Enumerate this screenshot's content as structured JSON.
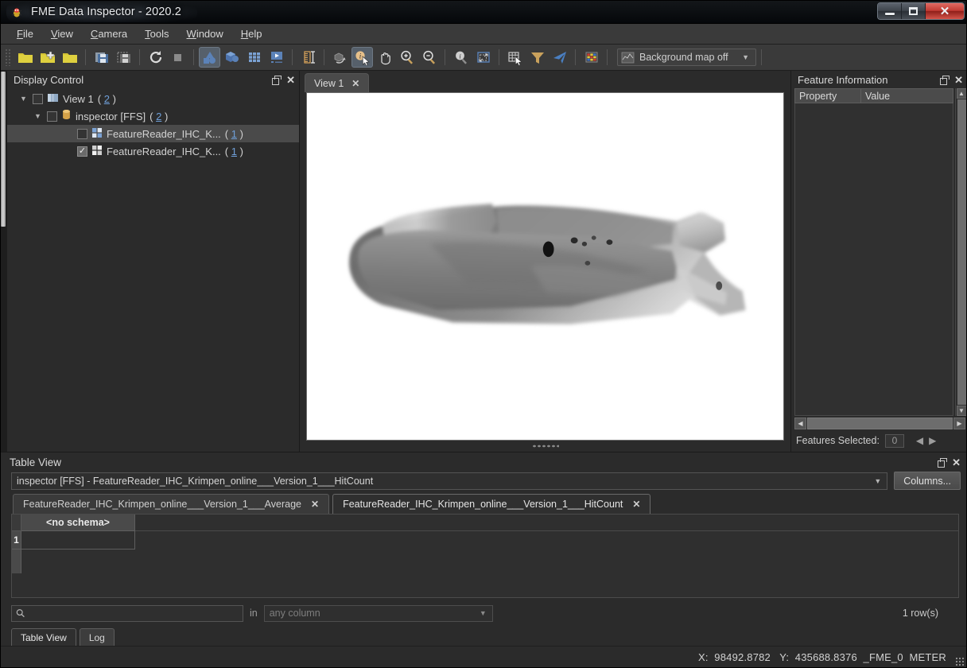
{
  "window": {
    "title": "FME Data Inspector - 2020.2",
    "app_icon": "fme-bug-icon",
    "minimize": "minimize-button",
    "maximize": "maximize-button",
    "close": "close-button"
  },
  "menu": {
    "items": [
      {
        "label": "File",
        "mnemonic": "F"
      },
      {
        "label": "View",
        "mnemonic": "V"
      },
      {
        "label": "Camera",
        "mnemonic": "C"
      },
      {
        "label": "Tools",
        "mnemonic": "T"
      },
      {
        "label": "Window",
        "mnemonic": "W"
      },
      {
        "label": "Help",
        "mnemonic": "H"
      }
    ]
  },
  "toolbar": {
    "background_map_label": "Background map off",
    "icons": [
      "open-folder-icon",
      "add-dataset-icon",
      "open-recent-folder-icon",
      "save-icon",
      "save-as-icon",
      "refresh-icon",
      "stop-icon",
      "show-features-icon",
      "3d-view-icon",
      "grid-view-icon",
      "animation-icon",
      "measure-icon",
      "rotate-icon",
      "info-select-icon",
      "pan-icon",
      "zoom-in-icon",
      "zoom-out-icon",
      "identify-icon",
      "zoom-to-box-icon",
      "table-select-icon",
      "filter-icon",
      "navigate-icon",
      "color-palette-icon",
      "background-map-icon"
    ]
  },
  "display_control": {
    "title": "Display Control",
    "tree": [
      {
        "label": "View 1",
        "count": "2",
        "checked": false,
        "expanded": true,
        "indent": 0,
        "icon": "view-icon",
        "selected": false
      },
      {
        "label": "inspector [FFS]",
        "count": "2",
        "checked": false,
        "expanded": true,
        "indent": 1,
        "icon": "dataset-icon",
        "selected": false
      },
      {
        "label": "FeatureReader_IHC_K...",
        "count": "1",
        "checked": false,
        "expanded": null,
        "indent": 2,
        "icon": "layer-icon",
        "selected": true
      },
      {
        "label": "FeatureReader_IHC_K...",
        "count": "1",
        "checked": true,
        "expanded": null,
        "indent": 2,
        "icon": "layer-icon",
        "selected": false
      }
    ]
  },
  "view": {
    "tab_label": "View 1",
    "close_label": "✕",
    "canvas_background": "#ffffff",
    "content": "grayscale-point-cloud-raster"
  },
  "feature_information": {
    "title": "Feature Information",
    "columns": [
      "Property",
      "Value"
    ],
    "rows": [],
    "features_selected_label": "Features Selected:",
    "features_selected_count": "0"
  },
  "table_view": {
    "title": "Table View",
    "dataset_selector_value": "inspector [FFS] - FeatureReader_IHC_Krimpen_online___Version_1___HitCount",
    "columns_button": "Columns...",
    "tabs": [
      {
        "label": "FeatureReader_IHC_Krimpen_online___Version_1___Average",
        "active": false,
        "close": "✕"
      },
      {
        "label": "FeatureReader_IHC_Krimpen_online___Version_1___HitCount",
        "active": true,
        "close": "✕"
      }
    ],
    "grid": {
      "headers": [
        "<no schema>"
      ],
      "rows": [
        {
          "num": "1",
          "cells": [
            ""
          ]
        }
      ]
    },
    "search_value": "",
    "search_placeholder": "",
    "search_in_label": "in",
    "column_filter_value": "any column",
    "row_count": "1 row(s)",
    "bottom_tabs": [
      {
        "label": "Table View",
        "active": true
      },
      {
        "label": "Log",
        "active": false
      }
    ]
  },
  "status_bar": {
    "x_label": "X:",
    "x_value": "98492.8782",
    "y_label": "Y:",
    "y_value": "435688.8376",
    "coordinate_system": "_FME_0",
    "units": "METER"
  },
  "colors": {
    "accent_blue": "#6f9fd8",
    "panel_bg": "#2b2b2b",
    "toolbar_bg": "#3a3a3a",
    "canvas_bg": "#ffffff",
    "close_red": "#c13b33"
  }
}
